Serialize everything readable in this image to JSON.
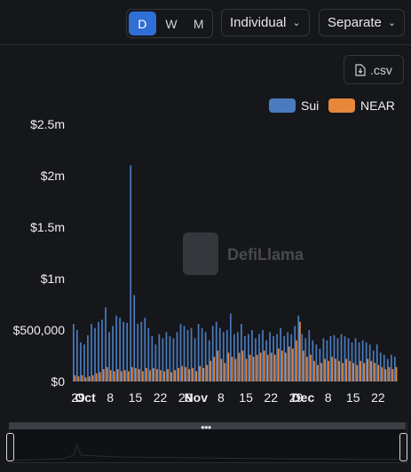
{
  "toolbar": {
    "periods": [
      "D",
      "W",
      "M"
    ],
    "active_period": "D",
    "mode_label": "Individual",
    "layout_label": "Separate",
    "csv_label": ".csv"
  },
  "watermark": "DefiLlama",
  "colors": {
    "sui": "#4a7bbf",
    "near": "#e8873a",
    "background": "#16171b"
  },
  "chart_data": {
    "type": "bar",
    "xlabel": "",
    "ylabel": "",
    "ylim": [
      0,
      2500000
    ],
    "y_ticks": [
      "$0",
      "$500,000",
      "$1m",
      "$1.5m",
      "$2m",
      "$2.5m"
    ],
    "x_ticks": [
      "29",
      "Oct",
      "8",
      "15",
      "22",
      "29",
      "Nov",
      "8",
      "15",
      "22",
      "29",
      "Dec",
      "8",
      "15",
      "22"
    ],
    "x_range": [
      "2023-09-28",
      "2023-12-24"
    ],
    "legend_position": "top-right",
    "grid": false,
    "series": [
      {
        "name": "Sui",
        "values": [
          560000,
          500000,
          380000,
          360000,
          450000,
          560000,
          520000,
          580000,
          600000,
          720000,
          480000,
          540000,
          640000,
          620000,
          580000,
          570000,
          2100000,
          840000,
          560000,
          580000,
          620000,
          520000,
          440000,
          360000,
          460000,
          420000,
          480000,
          440000,
          420000,
          480000,
          560000,
          540000,
          500000,
          520000,
          420000,
          560000,
          520000,
          480000,
          400000,
          540000,
          580000,
          520000,
          480000,
          500000,
          660000,
          460000,
          480000,
          560000,
          440000,
          460000,
          500000,
          420000,
          460000,
          500000,
          400000,
          480000,
          440000,
          460000,
          520000,
          440000,
          480000,
          460000,
          540000,
          640000,
          460000,
          420000,
          500000,
          400000,
          360000,
          320000,
          420000,
          400000,
          440000,
          450000,
          420000,
          460000,
          440000,
          420000,
          380000,
          420000,
          380000,
          400000,
          380000,
          360000,
          300000,
          360000,
          280000,
          260000,
          220000,
          260000,
          240000
        ]
      },
      {
        "name": "NEAR",
        "values": [
          60000,
          50000,
          60000,
          40000,
          50000,
          60000,
          80000,
          90000,
          120000,
          140000,
          110000,
          100000,
          120000,
          100000,
          110000,
          100000,
          140000,
          130000,
          120000,
          100000,
          130000,
          110000,
          130000,
          120000,
          110000,
          100000,
          120000,
          90000,
          110000,
          130000,
          150000,
          140000,
          120000,
          130000,
          100000,
          150000,
          130000,
          160000,
          200000,
          240000,
          300000,
          220000,
          180000,
          280000,
          240000,
          220000,
          280000,
          300000,
          220000,
          260000,
          240000,
          260000,
          280000,
          300000,
          260000,
          280000,
          260000,
          320000,
          300000,
          280000,
          340000,
          320000,
          400000,
          580000,
          300000,
          240000,
          260000,
          200000,
          160000,
          180000,
          220000,
          200000,
          240000,
          220000,
          200000,
          180000,
          220000,
          200000,
          180000,
          160000,
          200000,
          180000,
          220000,
          200000,
          180000,
          160000,
          140000,
          120000,
          140000,
          120000,
          140000
        ]
      }
    ]
  }
}
